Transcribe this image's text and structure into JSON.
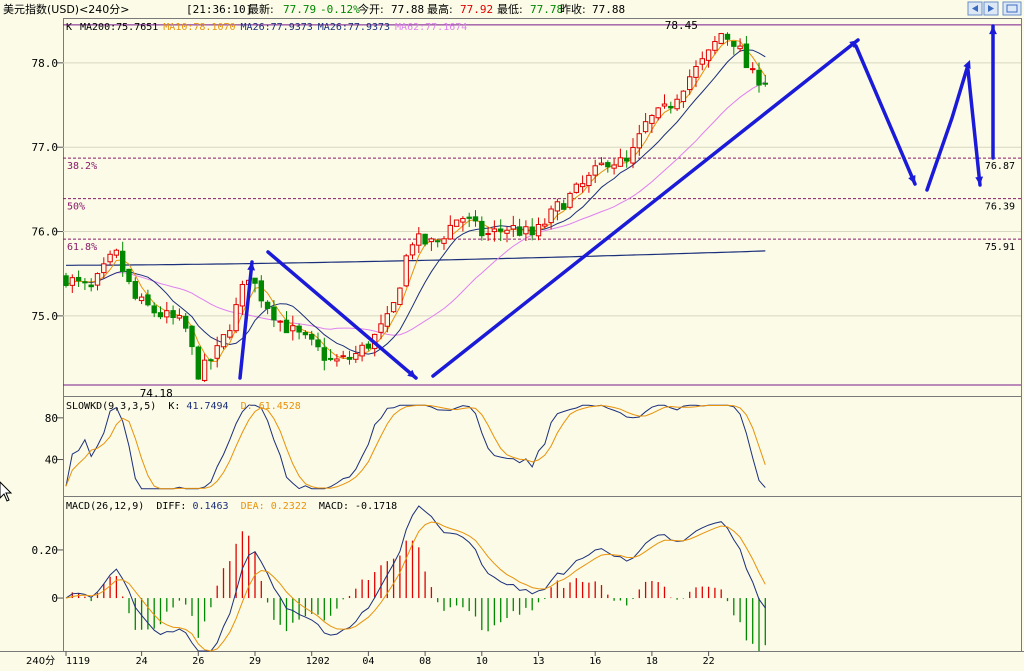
{
  "header": {
    "instrument": "美元指数(USD)<240分>",
    "time": "[21:36:10]",
    "latest_label": "最新:",
    "latest_value": "77.79",
    "change": "-0.12%",
    "open_label": "今开:",
    "open_value": "77.88",
    "high_label": "最高:",
    "high_value": "77.92",
    "low_label": "最低:",
    "low_value": "77.78",
    "prev_close_label": "昨收:",
    "prev_close_value": "77.88"
  },
  "colors": {
    "background": "#fbfbe8",
    "up_candle": "#e00000",
    "down_candle": "#008800",
    "ma_long": "#1c2f7a",
    "ma_mid": "#e8920a",
    "ma_slow": "#e080f0",
    "annotation_arrow": "#1a1ad8",
    "fib_line": "#8a1a6a"
  },
  "chart_data": [
    {
      "type": "candlestick",
      "panel": "main",
      "label": "K",
      "ma_legend": [
        {
          "name": "MA200",
          "value": "75.7651",
          "color": "#000000"
        },
        {
          "name": "MA10",
          "value": "78.1070",
          "color": "#e8920a"
        },
        {
          "name": "MA26",
          "value": "77.9373",
          "color": "#1c2f7a"
        },
        {
          "name": "MA26",
          "value": "77.9373",
          "color": "#1c2f7a"
        },
        {
          "name": "MA62",
          "value": "77.1674",
          "color": "#e080f0"
        }
      ],
      "y_ticks": [
        "78.0",
        "77.0",
        "76.0",
        "75.0"
      ],
      "y_tick_values": [
        78.0,
        77.0,
        76.0,
        75.0
      ],
      "ylim": [
        74.05,
        78.52
      ],
      "x_ticks": [
        "1119",
        "24",
        "26",
        "29",
        "1202",
        "04",
        "08",
        "10",
        "13",
        "16",
        "18",
        "22"
      ],
      "x_tick_index": [
        0,
        12,
        21,
        30,
        39,
        48,
        57,
        66,
        75,
        84,
        93,
        102
      ],
      "bar_count": 112,
      "price_path": [
        [
          0,
          75.45
        ],
        [
          5,
          75.3
        ],
        [
          10,
          75.75
        ],
        [
          14,
          75.2
        ],
        [
          18,
          75.05
        ],
        [
          24,
          74.9
        ],
        [
          27,
          74.3
        ],
        [
          31,
          74.6
        ],
        [
          34,
          75.0
        ],
        [
          37,
          75.5
        ],
        [
          40,
          75.2
        ],
        [
          44,
          74.9
        ],
        [
          50,
          74.65
        ],
        [
          54,
          74.45
        ],
        [
          58,
          74.5
        ],
        [
          62,
          74.7
        ],
        [
          66,
          75.0
        ],
        [
          70,
          75.9
        ],
        [
          75,
          75.85
        ],
        [
          80,
          76.2
        ],
        [
          85,
          75.95
        ],
        [
          90,
          76.05
        ],
        [
          95,
          75.95
        ],
        [
          100,
          76.3
        ],
        [
          105,
          76.55
        ],
        [
          110,
          76.85
        ],
        [
          114,
          76.8
        ],
        [
          118,
          77.3
        ],
        [
          122,
          77.45
        ],
        [
          126,
          77.8
        ],
        [
          130,
          78.05
        ],
        [
          133,
          78.35
        ],
        [
          136,
          78.25
        ],
        [
          139,
          77.85
        ],
        [
          142,
          77.8
        ]
      ],
      "bar_map_note_removed": true,
      "ma200_start": 75.6,
      "ma200_end": 75.77,
      "ma62_end": 77.17,
      "ma26_end": 77.94,
      "ma10_end": 78.11,
      "high_label": "78.45",
      "high_index": 96,
      "low_label": "74.18",
      "low_index": 19,
      "fib_lines": [
        {
          "label": "38.2%",
          "price_label": "76.87",
          "value": 76.87
        },
        {
          "label": "50%",
          "price_label": "76.39",
          "value": 76.39
        },
        {
          "label": "61.8%",
          "price_label": "75.91",
          "value": 75.91
        }
      ],
      "range_lines": [
        78.45,
        74.18
      ]
    },
    {
      "type": "line",
      "panel": "kd",
      "indicator": "SLOWKD(9,3,3,5)",
      "k_label": "K:",
      "k_value": "41.7494",
      "d_label": "D:",
      "d_value": "61.4528",
      "y_ticks": [
        "80",
        "40"
      ],
      "y_tick_values": [
        80,
        40
      ],
      "ylim": [
        5,
        100
      ]
    },
    {
      "type": "bar",
      "panel": "macd",
      "indicator": "MACD(26,12,9)",
      "diff_label": "DIFF:",
      "diff_value": "0.1463",
      "dea_label": "DEA:",
      "dea_value": "0.2322",
      "macd_label": "MACD:",
      "macd_value": "-0.1718",
      "y_ticks": [
        "0.20",
        "0"
      ],
      "y_tick_values": [
        0.2,
        0
      ],
      "ylim": [
        -0.22,
        0.42
      ]
    }
  ],
  "footer": {
    "period": "240分"
  }
}
